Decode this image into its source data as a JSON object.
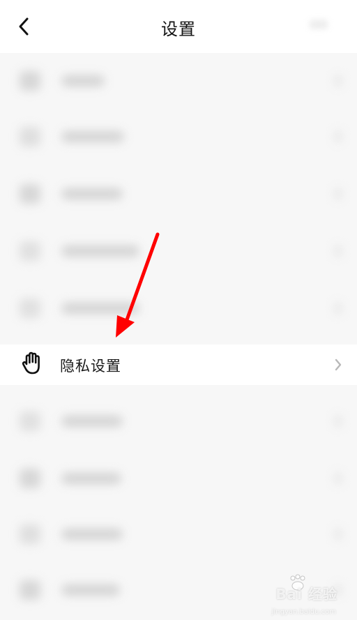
{
  "header": {
    "title": "设置",
    "back_icon": "chevron-left-icon"
  },
  "menu": {
    "highlighted_item": {
      "label": "隐私设置",
      "icon": "hand-icon",
      "chevron_icon": "chevron-right-icon"
    }
  },
  "annotation": {
    "arrow_color": "#ff0000"
  },
  "watermark": {
    "text": "Bai 经验",
    "sub_text": "jingyan.baidu.com"
  },
  "colors": {
    "background": "#f7f7f7",
    "row_background": "#ffffff",
    "text": "#1a1a1a"
  }
}
